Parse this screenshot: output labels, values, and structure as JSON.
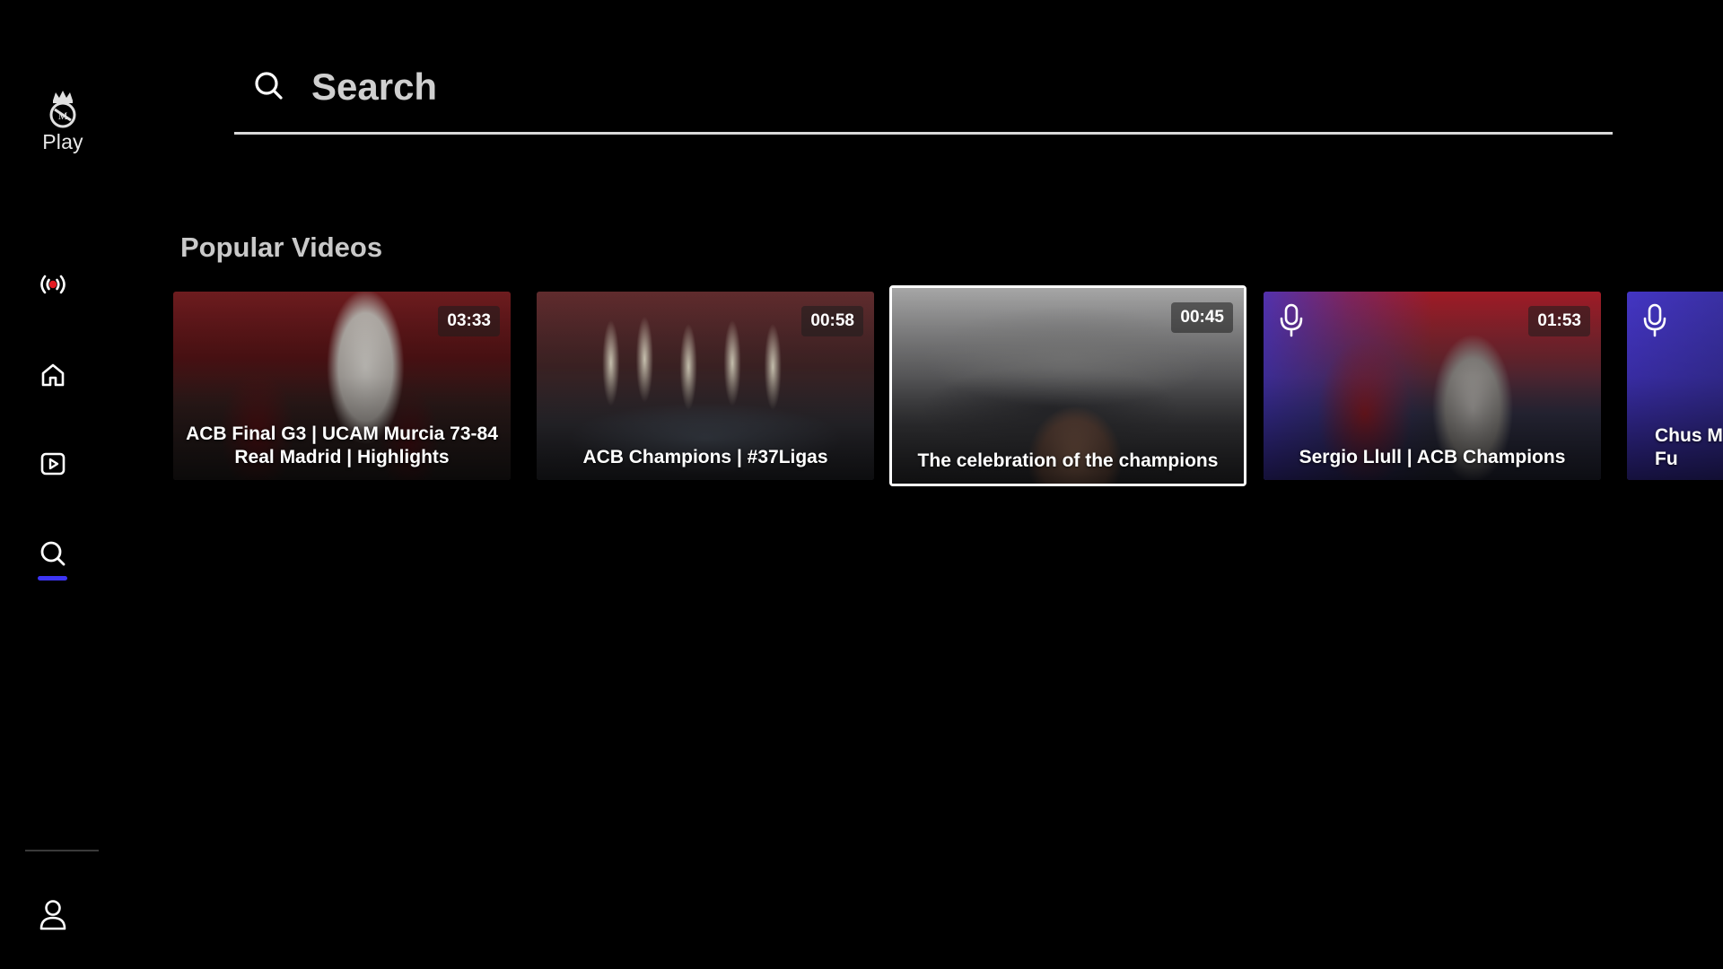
{
  "app": {
    "brand_label": "Play",
    "accent_color": "#3d35f5"
  },
  "sidebar": {
    "items": [
      {
        "id": "live",
        "icon": "live-broadcast-icon",
        "active": false
      },
      {
        "id": "home",
        "icon": "home-icon",
        "active": false
      },
      {
        "id": "videos",
        "icon": "video-play-icon",
        "active": false
      },
      {
        "id": "search",
        "icon": "search-icon",
        "active": true
      },
      {
        "id": "profile",
        "icon": "user-profile-icon",
        "active": false
      }
    ]
  },
  "search": {
    "placeholder": "Search",
    "value": ""
  },
  "popular": {
    "title": "Popular Videos",
    "videos": [
      {
        "title": "ACB Final G3 | UCAM Murcia 73-84 Real Madrid | Highlights",
        "duration": "03:33",
        "focused": false,
        "has_mic_icon": false
      },
      {
        "title": "ACB Champions | #37Ligas",
        "duration": "00:58",
        "focused": false,
        "has_mic_icon": false
      },
      {
        "title": "The celebration of the champions",
        "duration": "00:45",
        "focused": true,
        "has_mic_icon": false
      },
      {
        "title": "Sergio Llull | ACB Champions",
        "duration": "01:53",
        "focused": false,
        "has_mic_icon": true
      },
      {
        "title": "Chus M\nFu",
        "duration": "",
        "focused": false,
        "has_mic_icon": true
      }
    ]
  }
}
